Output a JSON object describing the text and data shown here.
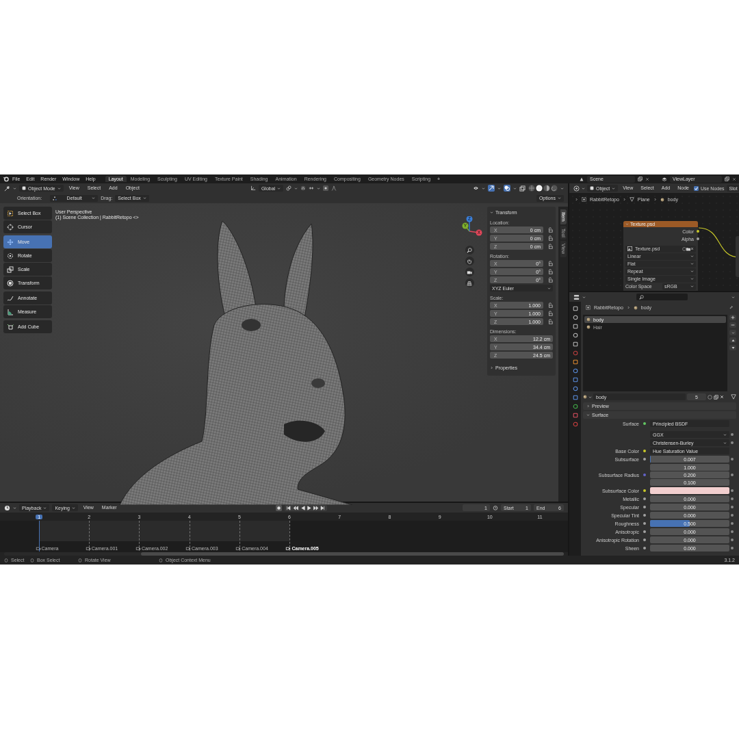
{
  "top_menu": [
    "File",
    "Edit",
    "Render",
    "Window",
    "Help"
  ],
  "workspace_tabs": [
    {
      "label": "Layout",
      "selected": true
    },
    {
      "label": "Modeling",
      "selected": false
    },
    {
      "label": "Sculpting",
      "selected": false
    },
    {
      "label": "UV Editing",
      "selected": false
    },
    {
      "label": "Texture Paint",
      "selected": false
    },
    {
      "label": "Shading",
      "selected": false
    },
    {
      "label": "Animation",
      "selected": false
    },
    {
      "label": "Rendering",
      "selected": false
    },
    {
      "label": "Compositing",
      "selected": false
    },
    {
      "label": "Geometry Nodes",
      "selected": false
    },
    {
      "label": "Scripting",
      "selected": false
    }
  ],
  "add_workspace": "+",
  "scene": "Scene",
  "view_layer": "ViewLayer",
  "viewport_header": {
    "mode": "Object Mode",
    "menus": [
      "View",
      "Select",
      "Add",
      "Object"
    ],
    "orientation": "Global",
    "gizmos_on": true,
    "overlays_on": true,
    "shading_modes": [
      {
        "kind": "wireframe",
        "selected": false
      },
      {
        "kind": "solid",
        "selected": true
      },
      {
        "kind": "material",
        "selected": false
      },
      {
        "kind": "rendered",
        "selected": false
      }
    ]
  },
  "tool_settings": {
    "orientation_label": "Orientation:",
    "orientation": "Default",
    "drag_label": "Drag:",
    "drag": "Select Box",
    "options": "Options"
  },
  "toolbar": [
    [
      {
        "label": "Select Box",
        "selected": false
      },
      {
        "label": "Cursor",
        "selected": false
      }
    ],
    [
      {
        "label": "Move",
        "selected": true
      },
      {
        "label": "Rotate",
        "selected": false
      },
      {
        "label": "Scale",
        "selected": false
      },
      {
        "label": "Transform",
        "selected": false
      }
    ],
    [
      {
        "label": "Annotate",
        "selected": false
      },
      {
        "label": "Measure",
        "selected": false
      }
    ],
    [
      {
        "label": "Add Cube",
        "selected": false
      }
    ]
  ],
  "viewport": {
    "view_name": "User Perspective",
    "collection": "(1) Scene Collection | RabbitRetopo <>"
  },
  "gizmo_axes": [
    {
      "label": "X",
      "color": "#e0475a"
    },
    {
      "label": "Y",
      "color": "#7fb02c"
    },
    {
      "label": "Z",
      "color": "#3b7fd8"
    }
  ],
  "transform": {
    "title": "Transform",
    "groups": [
      {
        "label": "Location:",
        "kind": "lockable",
        "rows": [
          {
            "axis": "X",
            "value": "0 cm"
          },
          {
            "axis": "Y",
            "value": "0 cm"
          },
          {
            "axis": "Z",
            "value": "0 cm"
          }
        ]
      },
      {
        "label": "Rotation:",
        "kind": "lockable",
        "rows": [
          {
            "axis": "X",
            "value": "0°"
          },
          {
            "axis": "Y",
            "value": "0°"
          },
          {
            "axis": "Z",
            "value": "0°"
          }
        ],
        "select": "XYZ Euler"
      },
      {
        "label": "Scale:",
        "kind": "lockable",
        "rows": [
          {
            "axis": "X",
            "value": "1.000"
          },
          {
            "axis": "Y",
            "value": "1.000"
          },
          {
            "axis": "Z",
            "value": "1.000"
          }
        ]
      },
      {
        "label": "Dimensions:",
        "kind": "plain",
        "rows": [
          {
            "axis": "X",
            "value": "12.2 cm"
          },
          {
            "axis": "Y",
            "value": "34.4 cm"
          },
          {
            "axis": "Z",
            "value": "24.5 cm"
          }
        ]
      }
    ],
    "properties": "Properties"
  },
  "sidebar_tabs": [
    {
      "label": "Item",
      "selected": true
    },
    {
      "label": "Tool",
      "selected": false
    },
    {
      "label": "View",
      "selected": false
    }
  ],
  "node_editor": {
    "type": "Object",
    "menus": [
      "View",
      "Select",
      "Add",
      "Node"
    ],
    "use_nodes": {
      "label": "Use Nodes",
      "checked": true
    },
    "slot": "Slot",
    "breadcrumb": [
      "RabbitRetopo",
      "Plane",
      "body"
    ],
    "node": {
      "title": "Texture.psd",
      "outputs": [
        {
          "label": "Color",
          "color": "#c7c729"
        },
        {
          "label": "Alpha",
          "color": "#a1a1a1"
        }
      ],
      "image": "Texture.psd",
      "selects": [
        "Linear",
        "Flat",
        "Repeat",
        "Single Image"
      ],
      "color_space_label": "Color Space",
      "color_space": "sRGB"
    }
  },
  "properties_editor": {
    "breadcrumb": [
      "RabbitRetopo",
      "body"
    ],
    "slots": [
      {
        "name": "body",
        "selected": true
      },
      {
        "name": "Hair",
        "selected": false
      }
    ],
    "material": {
      "name": "body",
      "users": "5"
    },
    "panels": [
      {
        "label": "Preview",
        "expanded": false
      },
      {
        "label": "Surface",
        "expanded": true
      }
    ],
    "rows": [
      {
        "kind": "link",
        "label": "Surface",
        "value": "Principled BSDF",
        "socket": {
          "color": "#63c763"
        }
      },
      {
        "kind": "select",
        "value": "GGX"
      },
      {
        "kind": "select",
        "value": "Christensen-Burley"
      },
      {
        "kind": "link",
        "label": "Base Color",
        "value": "Hue Saturation Value",
        "socket": {
          "color": "#c7c729"
        }
      },
      {
        "kind": "slider",
        "label": "Subsurface",
        "value": "0.007",
        "level": 0.007,
        "socket": {
          "color": "#a1a1a1"
        }
      },
      {
        "kind": "vector",
        "label": "Subsurface Radius",
        "values": [
          "1.000",
          "0.200",
          "0.100"
        ],
        "socket": {
          "color": "#6363c7"
        }
      },
      {
        "kind": "swatch",
        "label": "Subsurface Color",
        "swatch": {
          "color": "#f2cfcf"
        },
        "socket": {
          "color": "#c7c729"
        }
      },
      {
        "kind": "slider",
        "label": "Metallic",
        "value": "0.000",
        "level": 0,
        "socket": {
          "color": "#a1a1a1"
        }
      },
      {
        "kind": "slider",
        "label": "Specular",
        "value": "0.000",
        "level": 0,
        "socket": {
          "color": "#a1a1a1"
        }
      },
      {
        "kind": "slider",
        "label": "Specular Tint",
        "value": "0.000",
        "level": 0,
        "socket": {
          "color": "#a1a1a1"
        }
      },
      {
        "kind": "slider",
        "label": "Roughness",
        "value": "0.500",
        "level": 0.5,
        "socket": {
          "color": "#a1a1a1"
        }
      },
      {
        "kind": "slider",
        "label": "Anisotropic",
        "value": "0.000",
        "level": 0,
        "socket": {
          "color": "#a1a1a1"
        }
      },
      {
        "kind": "slider",
        "label": "Anisotropic Rotation",
        "value": "0.000",
        "level": 0,
        "socket": {
          "color": "#a1a1a1"
        }
      },
      {
        "kind": "slider",
        "label": "Sheen",
        "value": "0.000",
        "level": 0,
        "socket": {
          "color": "#a1a1a1"
        }
      }
    ]
  },
  "timeline": {
    "menus": [
      "Playback",
      "Keying",
      "View",
      "Marker"
    ],
    "current_frame": "1",
    "start_label": "Start",
    "start": "1",
    "end_label": "End",
    "end": "6",
    "frames": [
      {
        "label": "1",
        "selected": true
      },
      {
        "label": "2",
        "selected": false
      },
      {
        "label": "3",
        "selected": false
      },
      {
        "label": "4",
        "selected": false
      },
      {
        "label": "5",
        "selected": false
      },
      {
        "label": "6",
        "selected": false
      },
      {
        "label": "7",
        "selected": false
      },
      {
        "label": "8",
        "selected": false
      },
      {
        "label": "9",
        "selected": false
      },
      {
        "label": "10",
        "selected": false
      },
      {
        "label": "11",
        "selected": false
      }
    ],
    "markers": [
      {
        "label": "Camera",
        "selected": false
      },
      {
        "label": "Camera.001",
        "selected": false
      },
      {
        "label": "Camera.002",
        "selected": false
      },
      {
        "label": "Camera.003",
        "selected": false
      },
      {
        "label": "Camera.004",
        "selected": false
      },
      {
        "label": "Camera.005",
        "selected": true
      }
    ]
  },
  "status_bar": {
    "hints": [
      "Select",
      "Box Select",
      "Rotate View",
      "Object Context Menu"
    ],
    "version": "3.1.2"
  }
}
